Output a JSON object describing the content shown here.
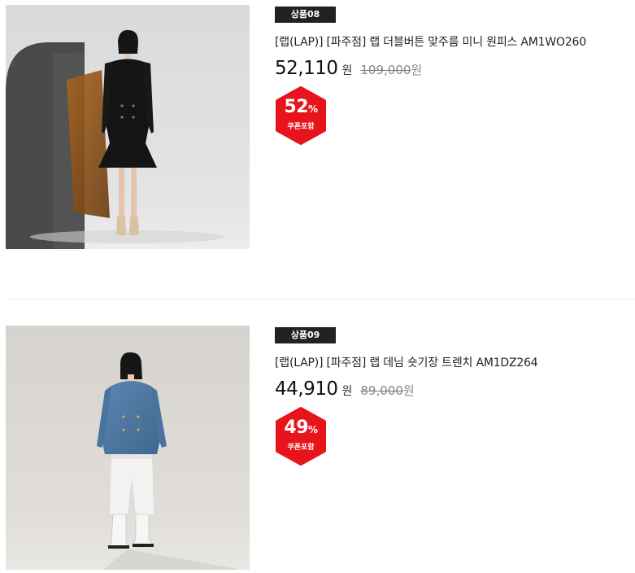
{
  "products": [
    {
      "badge": "상품08",
      "title": "[랩(LAP)] [파주점] 랩 더블버튼 맞주름 미니 원피스 AM1WO260",
      "price": "52,110",
      "currency": "원",
      "original_price": "109,000",
      "original_currency": "원",
      "discount_value": "52",
      "discount_unit": "%",
      "discount_label": "쿠폰포함",
      "image": "model-black-mini-dress"
    },
    {
      "badge": "상품09",
      "title": "[랩(LAP)] [파주점] 랩 데님 숏기장 트렌치 AM1DZ264",
      "price": "44,910",
      "currency": "원",
      "original_price": "89,000",
      "original_currency": "원",
      "discount_value": "49",
      "discount_unit": "%",
      "discount_label": "쿠폰포함",
      "image": "model-denim-trench"
    }
  ],
  "colors": {
    "badge_bg": "#222222",
    "coupon_red": "#e8141c",
    "text_dark": "#111111",
    "text_muted": "#888888"
  }
}
